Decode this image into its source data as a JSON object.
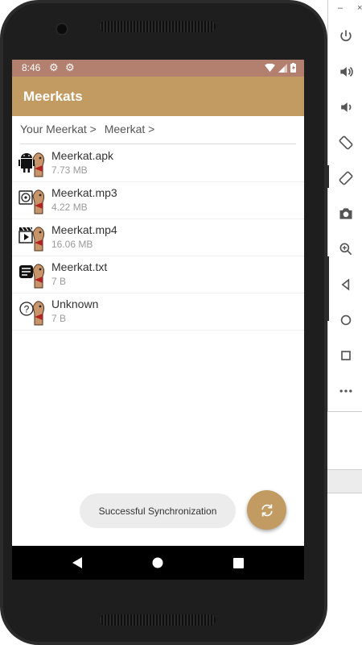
{
  "status_bar": {
    "time": "8:46",
    "icons": [
      "gear-icon",
      "gear-icon",
      "wifi-icon",
      "signal-icon",
      "battery-icon"
    ]
  },
  "app_bar": {
    "title": "Meerkats"
  },
  "breadcrumb": {
    "items": [
      "Your Meerkat >",
      "Meerkat >"
    ]
  },
  "files": [
    {
      "name": "Meerkat.apk",
      "size": "7.73 MB",
      "icon": "android-icon"
    },
    {
      "name": "Meerkat.mp3",
      "size": "4.22 MB",
      "icon": "audio-file-icon"
    },
    {
      "name": "Meerkat.mp4",
      "size": "16.06 MB",
      "icon": "video-file-icon"
    },
    {
      "name": "Meerkat.txt",
      "size": "7 B",
      "icon": "text-file-icon"
    },
    {
      "name": "Unknown",
      "size": "7 B",
      "icon": "unknown-file-icon"
    }
  ],
  "toast": {
    "text": "Successful Synchronization"
  },
  "fab": {
    "icon": "sync-icon"
  },
  "nav_bar": {
    "buttons": [
      "back-icon",
      "home-icon",
      "recents-icon"
    ]
  },
  "emulator_panel": {
    "window_controls": [
      "–",
      "×"
    ],
    "buttons": [
      "power-icon",
      "volume-up-icon",
      "volume-down-icon",
      "rotate-left-icon",
      "rotate-right-icon",
      "camera-icon",
      "zoom-icon",
      "back-icon",
      "home-icon",
      "overview-icon",
      "more-icon"
    ]
  },
  "colors": {
    "status_bar": "#b37f6f",
    "app_bar": "#c19b62",
    "fab": "#c19b62",
    "toast_bg": "#ececec"
  }
}
